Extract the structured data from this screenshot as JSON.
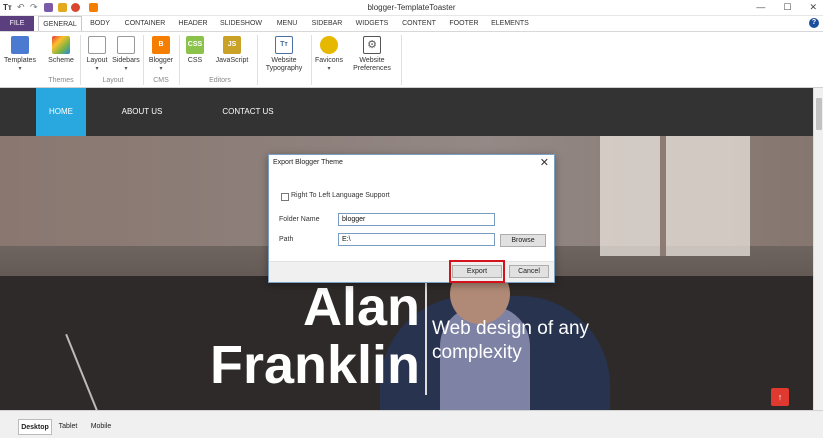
{
  "app": {
    "logo": "Tт",
    "window_title": "blogger-TemplateToaster",
    "controls": [
      "—",
      "☐",
      "✕"
    ]
  },
  "menu": {
    "tabs": [
      "FILE",
      "GENERAL",
      "BODY",
      "CONTAINER",
      "HEADER",
      "SLIDESHOW",
      "MENU",
      "SIDEBAR",
      "WIDGETS",
      "CONTENT",
      "FOOTER",
      "ELEMENTS"
    ],
    "active": "GENERAL",
    "help": "?"
  },
  "ribbon": {
    "buttons": {
      "templates": "Templates",
      "scheme": "Scheme",
      "layout": "Layout",
      "sidebars": "Sidebars",
      "blogger": "Blogger",
      "css": "CSS",
      "javascript": "JavaScript",
      "website_typography_1": "Website",
      "website_typography_2": "Typography",
      "favicons": "Favicons",
      "website_preferences_1": "Website",
      "website_preferences_2": "Preferences"
    },
    "groups": {
      "themes": "Themes",
      "layout": "Layout",
      "cms": "CMS",
      "editors": "Editors"
    },
    "colors": {
      "templates": "#4a7bd0",
      "scheme": "#7cb342",
      "blogger": "#f57d00",
      "css": "#8bc34a",
      "javascript": "#c9a227",
      "typography": "#4a6fa5",
      "favicons": "#e6b800",
      "preferences": "#555555"
    }
  },
  "site": {
    "nav": [
      "HOME",
      "ABOUT US",
      "CONTACT US"
    ],
    "active_nav": "HOME",
    "accent": "#29a8e0",
    "hero": {
      "name_line1": "Alan",
      "name_line2": "Franklin",
      "tagline": "Web design of any complexity"
    },
    "back_to_top": "↑"
  },
  "dialog": {
    "title": "Export Blogger Theme",
    "close": "✕",
    "rtl_label": "Right To Left Language Support",
    "rtl_checked": false,
    "folder_label": "Folder Name",
    "folder_value": "blogger",
    "path_label": "Path",
    "path_value": "E:\\",
    "browse": "Browse",
    "export": "Export",
    "cancel": "Cancel"
  },
  "statusbar": {
    "views": [
      "Desktop",
      "Tablet",
      "Mobile"
    ],
    "active_view": "Desktop"
  }
}
